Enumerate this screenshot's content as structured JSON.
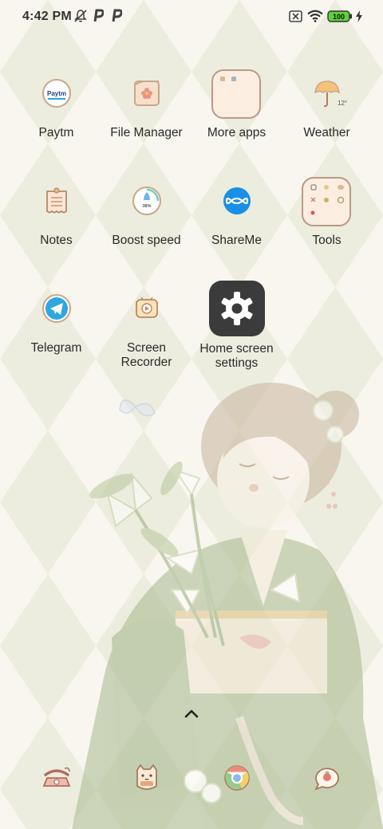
{
  "status_bar": {
    "time": "4:42 PM",
    "battery_level": "100",
    "icons": [
      "mute-notifications-icon",
      "paytm-p-icon",
      "paytm-p-icon",
      "no-sim-icon",
      "wifi-icon",
      "battery-icon",
      "charging-bolt-icon"
    ]
  },
  "apps": [
    {
      "label": "Paytm",
      "icon": "paytm-icon"
    },
    {
      "label": "File Manager",
      "icon": "folder-icon"
    },
    {
      "label": "More apps",
      "icon": "app-folder-icon"
    },
    {
      "label": "Weather",
      "icon": "umbrella-icon"
    },
    {
      "label": "Notes",
      "icon": "notepad-icon"
    },
    {
      "label": "Boost speed",
      "icon": "rocket-icon"
    },
    {
      "label": "ShareMe",
      "icon": "infinity-icon"
    },
    {
      "label": "Tools",
      "icon": "tools-folder-icon"
    },
    {
      "label": "Telegram",
      "icon": "paper-plane-icon"
    },
    {
      "label": "Screen\nRecorder",
      "icon": "video-camera-icon"
    },
    {
      "label": "Home screen\nsettings",
      "icon": "gear-icon"
    }
  ],
  "weather": {
    "temperature": "12°"
  },
  "boost": {
    "percent": "38%"
  },
  "dock": [
    {
      "name": "phone",
      "icon": "telephone-icon"
    },
    {
      "name": "contacts",
      "icon": "cat-icon"
    },
    {
      "name": "browser",
      "icon": "chrome-icon"
    },
    {
      "name": "messages",
      "icon": "message-bubble-icon"
    }
  ],
  "colors": {
    "background": "#f8f6ef",
    "diamond": "#ecedde",
    "icon_outline": "#c9a68a",
    "battery": "#5fd23a",
    "shareme_blue": "#1a8fe6",
    "telegram_blue": "#2ea6e0",
    "settings_tile": "#3b3b3b"
  }
}
